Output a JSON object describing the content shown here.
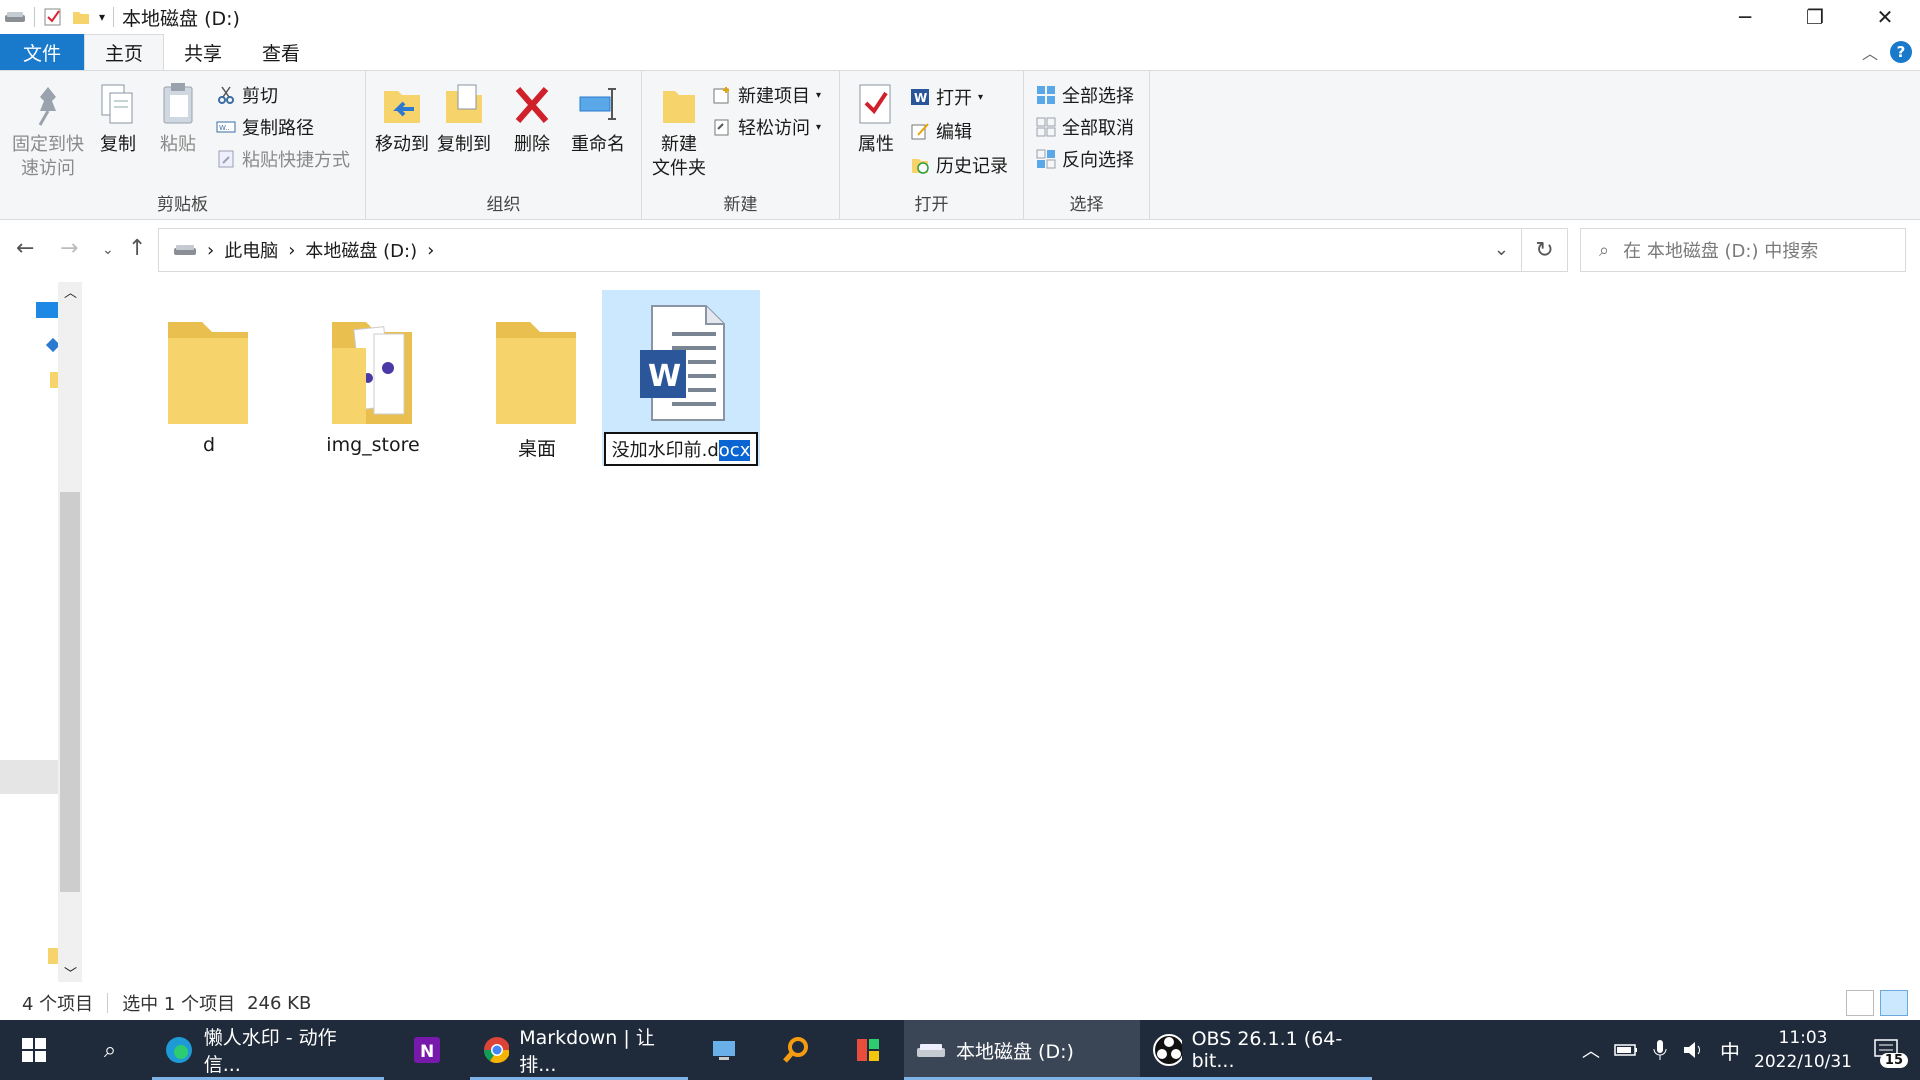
{
  "window": {
    "title": "本地磁盘 (D:)",
    "controls": {
      "minimize": "─",
      "restore": "❐",
      "close": "✕"
    }
  },
  "ribbon_tabs": [
    {
      "label": "文件"
    },
    {
      "label": "主页"
    },
    {
      "label": "共享"
    },
    {
      "label": "查看"
    }
  ],
  "ribbon": {
    "clipboard": {
      "label": "剪贴板",
      "pin_line1": "固定到快",
      "pin_line2": "速访问",
      "copy": "复制",
      "paste": "粘贴",
      "cut": "剪切",
      "copy_path": "复制路径",
      "paste_shortcut": "粘贴快捷方式"
    },
    "organize": {
      "label": "组织",
      "move_to": "移动到",
      "copy_to": "复制到",
      "delete": "删除",
      "rename": "重命名"
    },
    "new": {
      "label": "新建",
      "new_folder_line1": "新建",
      "new_folder_line2": "文件夹",
      "new_item": "新建项目",
      "easy_access": "轻松访问"
    },
    "open": {
      "label": "打开",
      "properties": "属性",
      "open": "打开",
      "edit": "编辑",
      "history": "历史记录"
    },
    "select": {
      "label": "选择",
      "select_all": "全部选择",
      "select_none": "全部取消",
      "invert": "反向选择"
    }
  },
  "address": {
    "crumbs": [
      "此电脑",
      "本地磁盘 (D:)"
    ],
    "search_placeholder": "在 本地磁盘 (D:) 中搜索"
  },
  "files": [
    {
      "name": "d",
      "type": "folder"
    },
    {
      "name": "img_store",
      "type": "folder-with-images"
    },
    {
      "name": "桌面",
      "type": "folder"
    },
    {
      "name_editing_base": "没加水印前.d",
      "name_editing_selected": "ocx",
      "type": "word-document",
      "selected": true
    }
  ],
  "status": {
    "item_count": "4 个项目",
    "selection": "选中 1 个项目",
    "size": "246 KB"
  },
  "taskbar": {
    "apps": [
      {
        "label": "懒人水印 - 动作信...",
        "icon": "edge-icon"
      },
      {
        "label": "",
        "icon": "onenote-icon"
      },
      {
        "label": "Markdown | 让排...",
        "icon": "chrome-icon"
      },
      {
        "label": "",
        "icon": "pc-icon"
      },
      {
        "label": "",
        "icon": "search-app-icon"
      },
      {
        "label": "",
        "icon": "colorful-app-icon"
      },
      {
        "label": "本地磁盘 (D:)",
        "icon": "drive-icon"
      },
      {
        "label": "OBS 26.1.1 (64-bit...",
        "icon": "obs-icon"
      }
    ],
    "ime": "中",
    "time": "11:03",
    "date": "2022/10/31",
    "notification_count": "15"
  },
  "colors": {
    "accent": "#1979ca",
    "selection": "#cce8ff",
    "taskbar": "#1f2a3a",
    "folder": "#f7d36b"
  }
}
